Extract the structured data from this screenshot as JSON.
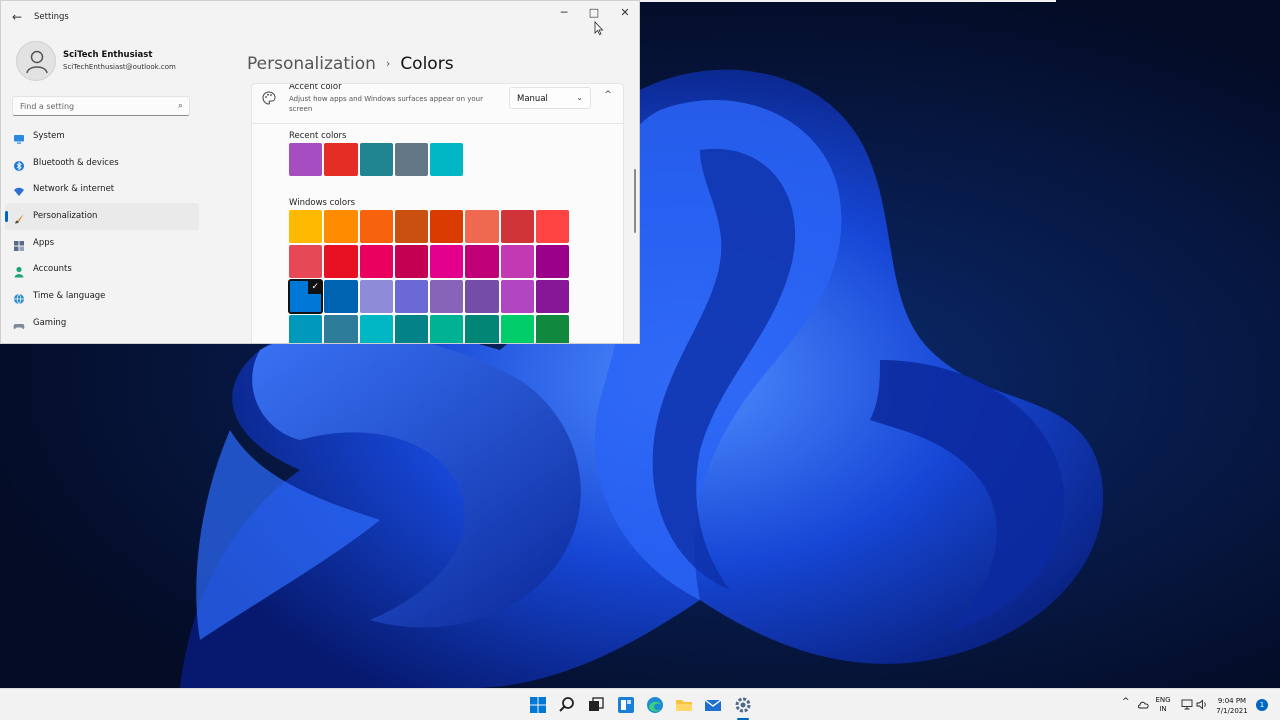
{
  "window": {
    "title": "Settings",
    "back_icon": "back-arrow-icon",
    "controls": {
      "minimize": "─",
      "maximize": "□",
      "close": "✕"
    }
  },
  "user": {
    "name": "SciTech Enthusiast",
    "email": "SciTechEnthusiast@outlook.com"
  },
  "search": {
    "placeholder": "Find a setting",
    "icon": "⌕"
  },
  "sidebar": {
    "items": [
      {
        "label": "System",
        "icon": "monitor-icon",
        "color": "#2b8ae0"
      },
      {
        "label": "Bluetooth & devices",
        "icon": "bluetooth-icon",
        "color": "#1e78d6"
      },
      {
        "label": "Network & internet",
        "icon": "wifi-icon",
        "color": "#2a6fd1"
      },
      {
        "label": "Personalization",
        "icon": "brush-icon",
        "color": "#d98a2a",
        "active": true
      },
      {
        "label": "Apps",
        "icon": "apps-icon",
        "color": "#5a6d86"
      },
      {
        "label": "Accounts",
        "icon": "person-icon",
        "color": "#1ea37a"
      },
      {
        "label": "Time & language",
        "icon": "globe-icon",
        "color": "#2a8ac8"
      },
      {
        "label": "Gaming",
        "icon": "gamepad-icon",
        "color": "#7d8a99"
      }
    ]
  },
  "breadcrumb": {
    "parent": "Personalization",
    "separator": "›",
    "current": "Colors"
  },
  "accent": {
    "title": "Accent color",
    "description": "Adjust how apps and Windows surfaces appear on your screen",
    "mode": "Manual",
    "dropdown_chevron": "⌄",
    "collapse_chevron": "^"
  },
  "recent_colors": {
    "label": "Recent colors",
    "colors": [
      "#a64dbf",
      "#e32d25",
      "#218591",
      "#637685",
      "#00b7c3"
    ]
  },
  "windows_colors": {
    "label": "Windows colors",
    "selected_index": 16,
    "colors": [
      "#ffb900",
      "#ff8c00",
      "#f7630c",
      "#ca5010",
      "#da3b01",
      "#ef6950",
      "#d13438",
      "#ff4343",
      "#e74856",
      "#e81123",
      "#ea005e",
      "#c30052",
      "#e3008c",
      "#bf0077",
      "#c239b3",
      "#9a0089",
      "#0078d7",
      "#0063b1",
      "#8e8cd8",
      "#6b69d6",
      "#8764b8",
      "#744da9",
      "#b146c2",
      "#881798",
      "#0099bc",
      "#2d7d9a",
      "#00b7c3",
      "#038387",
      "#00b294",
      "#018574",
      "#00cc6a",
      "#10893e"
    ]
  },
  "taskbar": {
    "apps": [
      "windows-start-icon",
      "search-icon",
      "task-view-icon",
      "widgets-icon",
      "edge-icon",
      "file-explorer-icon",
      "mail-icon",
      "settings-icon"
    ],
    "tray": {
      "chevron": "^",
      "lang_line1": "ENG",
      "lang_line2": "IN",
      "time": "9:04 PM",
      "date": "7/1/2021",
      "notifications": "1"
    }
  },
  "colors": {
    "accent": "#0067c0",
    "wallpaper": "#1747d6"
  }
}
